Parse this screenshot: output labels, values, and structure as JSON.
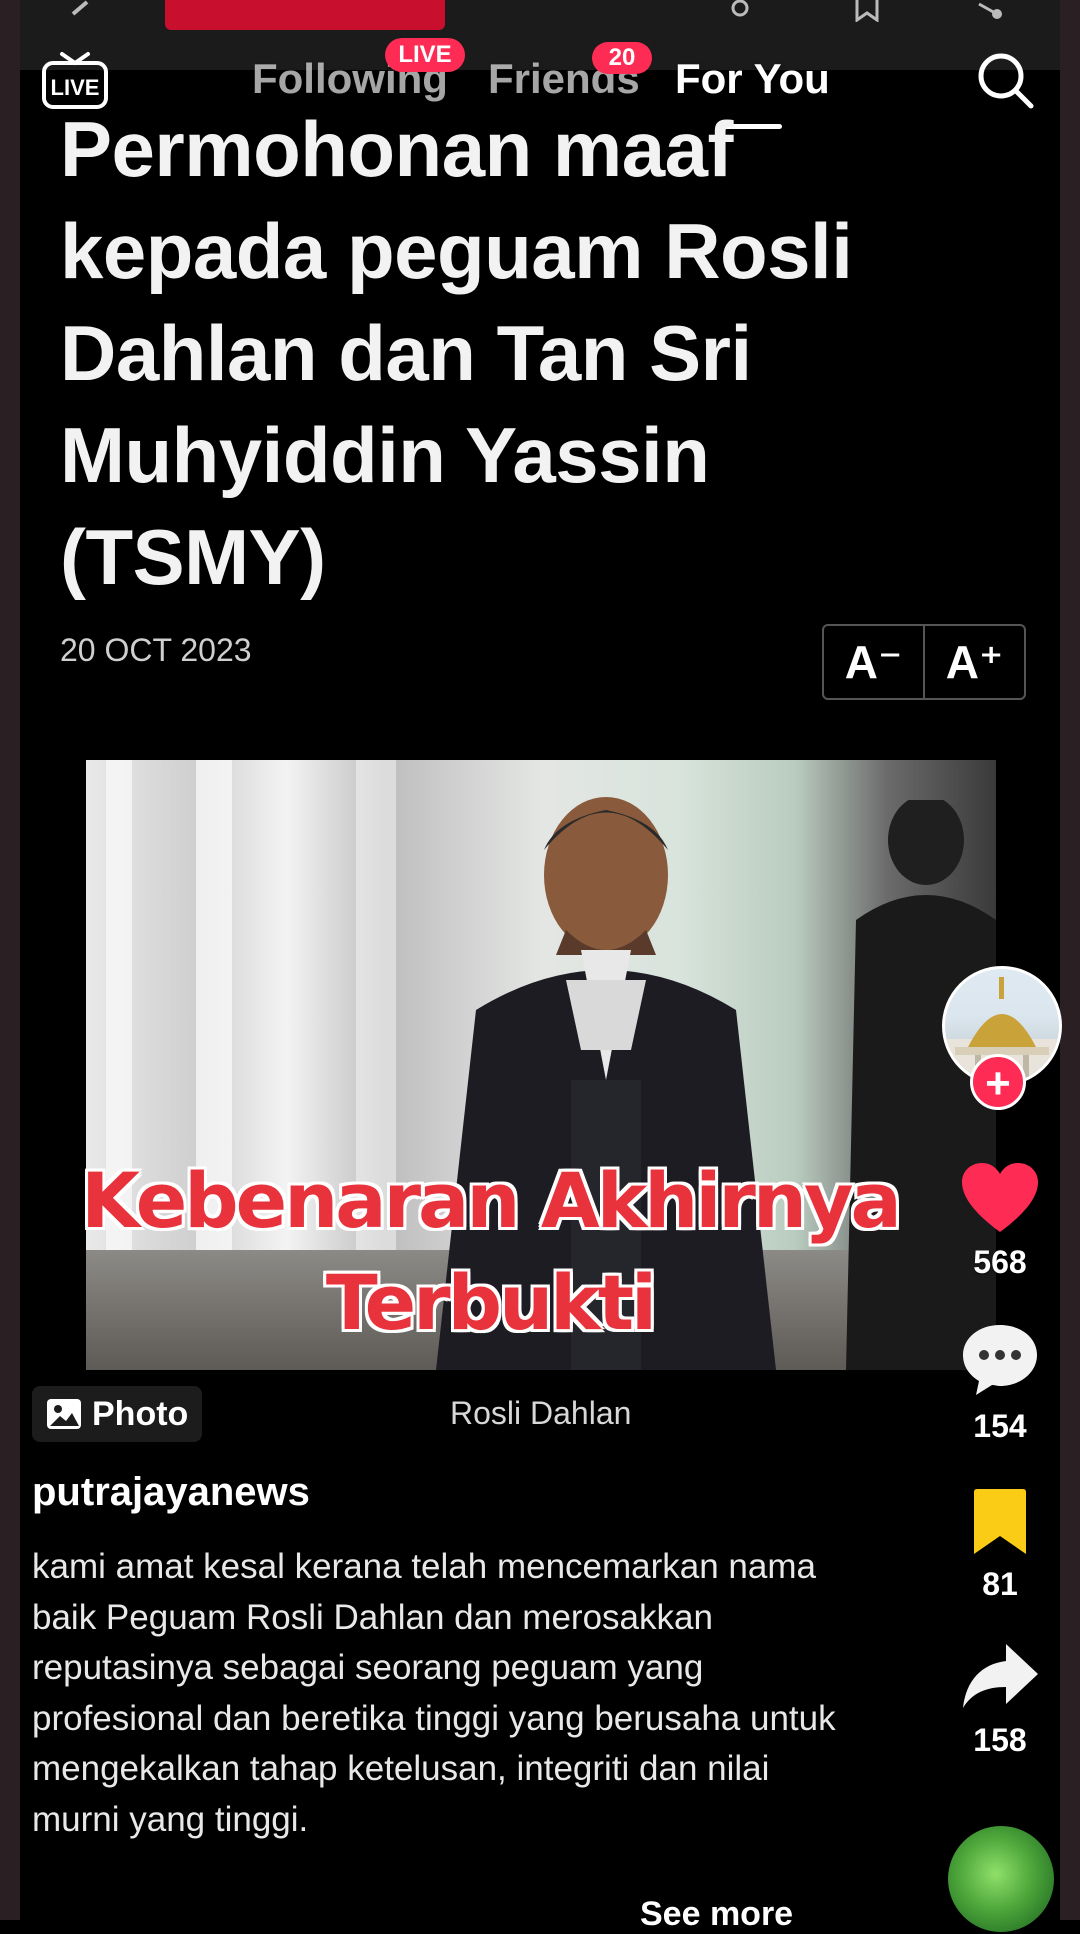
{
  "top_nav": {
    "live_label": "LIVE",
    "following_label": "Following",
    "following_badge": "LIVE",
    "friends_label": "Friends",
    "friends_badge": "20",
    "for_you_label": "For You",
    "active_tab": "For You"
  },
  "article": {
    "headline": "Permohonan maaf kepada peguam Rosli Dahlan dan Tan Sri Muhyiddin Yassin (TSMY)",
    "date": "20 OCT 2023",
    "font_decrease": "A⁻",
    "font_increase": "A⁺",
    "photo_caption": "Rosli Dahlan"
  },
  "overlay": {
    "line1": "Kebenaran Akhirnya",
    "line2": "Terbukti"
  },
  "photo_chip": {
    "label": "Photo",
    "icon": "image-icon"
  },
  "post": {
    "username": "putrajayanews",
    "description": "kami amat kesal kerana telah mencemarkan nama baik Peguam Rosli Dahlan dan merosakkan reputasinya sebagai seorang peguam yang profesional dan beretika tinggi yang berusaha untuk mengekalkan tahap ketelusan, integriti dan nilai murni yang tinggi.",
    "see_more": "See more"
  },
  "actions": {
    "likes": "568",
    "comments": "154",
    "saves": "81",
    "shares": "158"
  },
  "colors": {
    "accent": "#fe2c55",
    "like": "#fe2c55",
    "save": "#facc15",
    "overlay_text": "#e8323c"
  }
}
